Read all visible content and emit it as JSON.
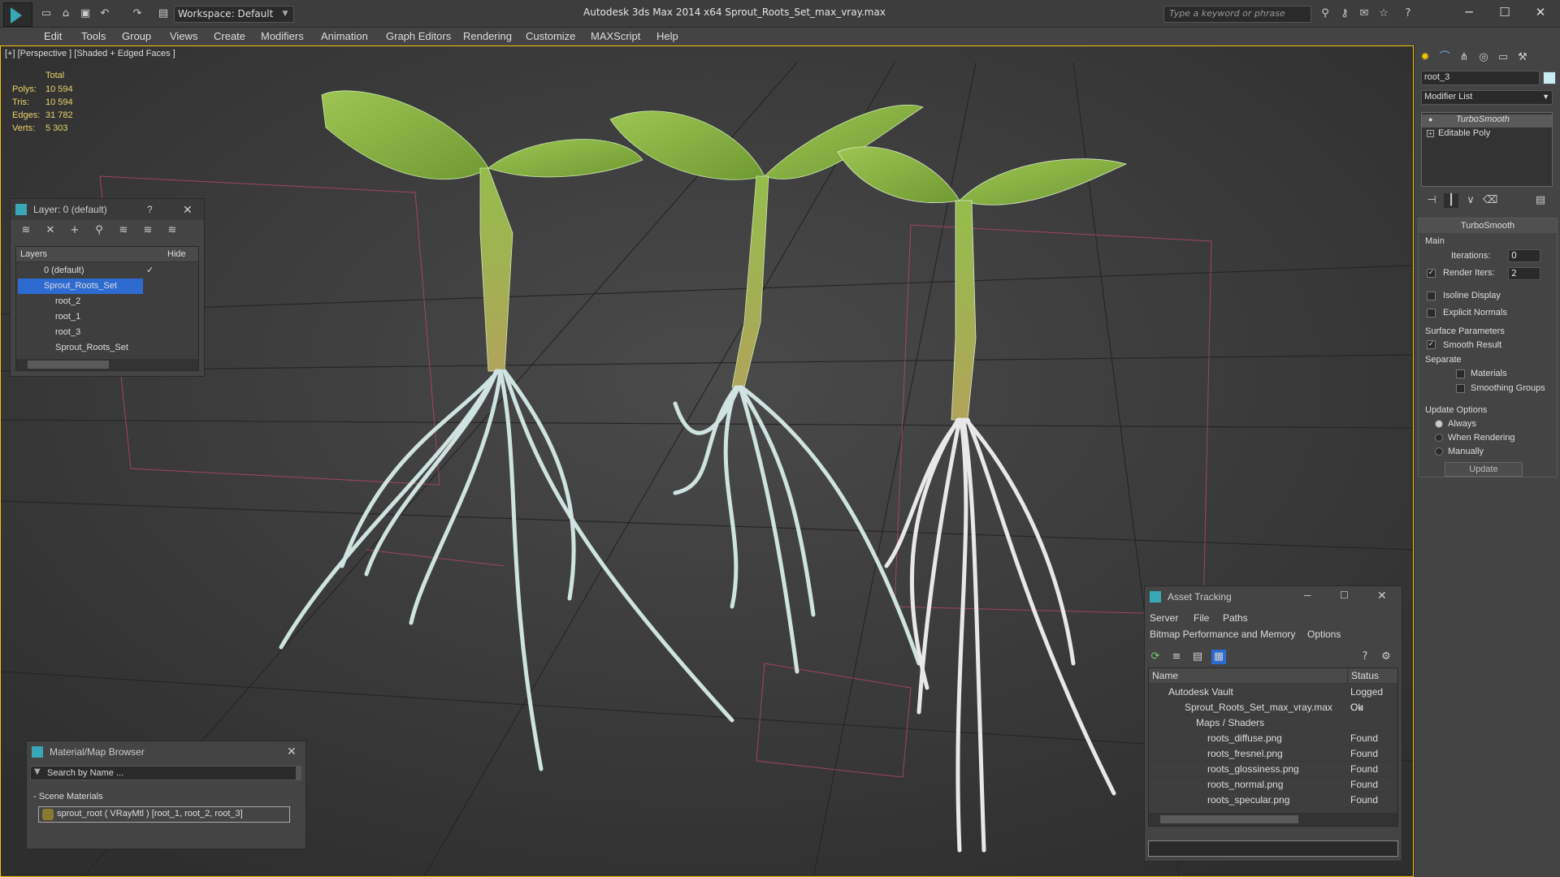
{
  "window": {
    "app_title": "Autodesk 3ds Max  2014 x64      Sprout_Roots_Set_max_vray.max",
    "workspace": "Workspace: Default",
    "search_placeholder": "Type a keyword or phrase"
  },
  "menu": [
    "Edit",
    "Tools",
    "Group",
    "Views",
    "Create",
    "Modifiers",
    "Animation",
    "Graph Editors",
    "Rendering",
    "Customize",
    "MAXScript",
    "Help"
  ],
  "viewport": {
    "label": "[+] [Perspective ] [Shaded + Edged Faces ]",
    "stats": {
      "header": "Total",
      "rows": [
        {
          "label": "Polys:",
          "value": "10 594"
        },
        {
          "label": "Tris:",
          "value": "10 594"
        },
        {
          "label": "Edges:",
          "value": "31 782"
        },
        {
          "label": "Verts:",
          "value": "5 303"
        }
      ]
    }
  },
  "layer_dialog": {
    "title": "Layer: 0 (default)",
    "help": "?",
    "col_layers": "Layers",
    "col_hide": "Hide",
    "rows": [
      {
        "name": "0 (default)"
      },
      {
        "name": "Sprout_Roots_Set"
      },
      {
        "name": "root_2"
      },
      {
        "name": "root_1"
      },
      {
        "name": "root_3"
      },
      {
        "name": "Sprout_Roots_Set"
      }
    ]
  },
  "material_browser": {
    "title": "Material/Map Browser",
    "search_placeholder": "Search by Name ...",
    "section": "- Scene Materials",
    "item": "sprout_root  ( VRayMtl ) [root_1, root_2, root_3]"
  },
  "asset_tracking": {
    "title": "Asset Tracking",
    "menu_row1": [
      "Server",
      "File",
      "Paths"
    ],
    "menu_row2": [
      "Bitmap Performance and Memory",
      "Options"
    ],
    "col_name": "Name",
    "col_status": "Status",
    "rows": [
      {
        "name": "Autodesk Vault",
        "status": "Logged Ou"
      },
      {
        "name": "Sprout_Roots_Set_max_vray.max",
        "status": "Ok"
      },
      {
        "name": "Maps / Shaders",
        "status": ""
      },
      {
        "name": "roots_diffuse.png",
        "status": "Found"
      },
      {
        "name": "roots_fresnel.png",
        "status": "Found"
      },
      {
        "name": "roots_glossiness.png",
        "status": "Found"
      },
      {
        "name": "roots_normal.png",
        "status": "Found"
      },
      {
        "name": "roots_specular.png",
        "status": "Found"
      }
    ]
  },
  "command_panel": {
    "object_name": "root_3",
    "modifier_list": "Modifier List",
    "stack": [
      "TurboSmooth",
      "Editable Poly"
    ],
    "rollout_title": "TurboSmooth",
    "main": "Main",
    "iterations_label": "Iterations:",
    "iterations_value": "0",
    "render_iters_label": "Render Iters:",
    "render_iters_value": "2",
    "isoline": "Isoline Display",
    "explicit_normals": "Explicit Normals",
    "surface_params": "Surface Parameters",
    "smooth_result": "Smooth Result",
    "separate": "Separate",
    "materials": "Materials",
    "smoothing_groups": "Smoothing Groups",
    "update_options": "Update Options",
    "always": "Always",
    "when_rendering": "When Rendering",
    "manually": "Manually",
    "update_btn": "Update"
  },
  "colors": {
    "accent": "#f2c300",
    "selection": "#2e6bd1",
    "plant_green": "#8fb84a",
    "root_white": "#d8e6e6"
  }
}
